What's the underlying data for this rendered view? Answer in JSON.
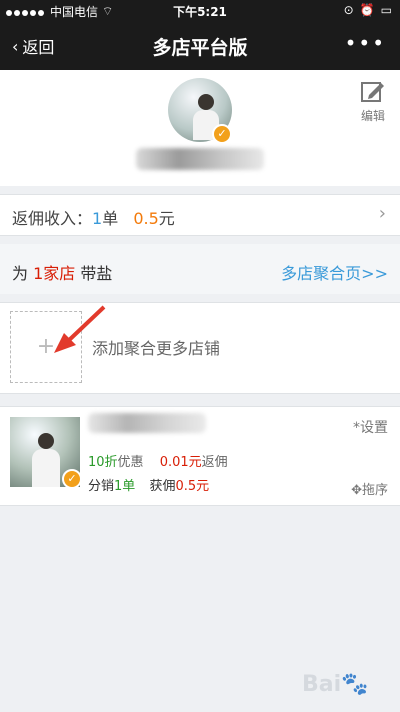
{
  "status_bar": {
    "carrier": "中国电信",
    "time": "下午5:21"
  },
  "nav": {
    "back_label": "返回",
    "title": "多店平台版",
    "more_label": "•••"
  },
  "profile": {
    "edit_label": "编辑"
  },
  "commission": {
    "label_prefix": "返佣收入：",
    "count": "1",
    "count_unit": "单",
    "amount": "0.5",
    "amount_unit": "元"
  },
  "stores_header": {
    "prefix": "为 ",
    "count": "1家店",
    "suffix": " 带盐",
    "link": "多店聚合页>>"
  },
  "add_store": {
    "plus": "+",
    "label": "添加聚合更多店铺"
  },
  "shop": {
    "discount": "10折",
    "discount_label": "优惠",
    "commission_value": "0.01元",
    "commission_label": "返佣",
    "sales_prefix": "分销",
    "sales_value": "1单",
    "earnings_prefix": "获佣",
    "earnings_value": "0.5元",
    "settings_label": "设置",
    "sort_label": "拖序"
  },
  "watermark": {
    "text": "Bai"
  }
}
